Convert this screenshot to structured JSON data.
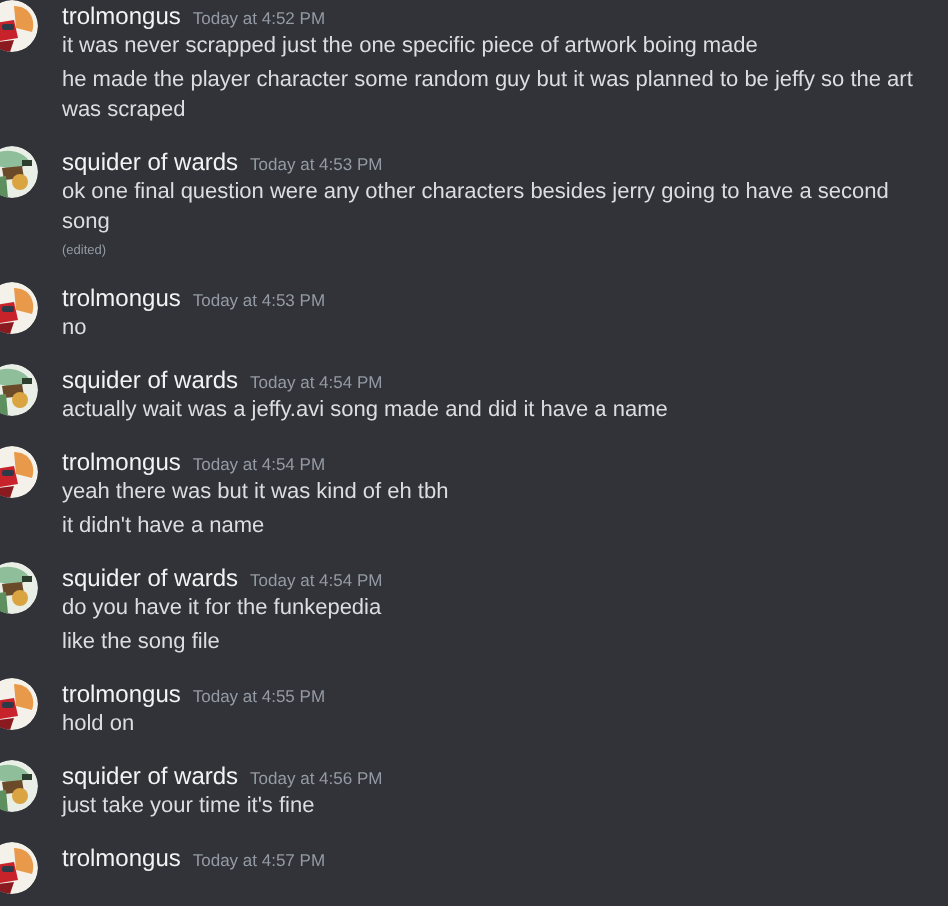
{
  "messages": [
    {
      "author": "trolmongus",
      "time": "Today at 4:52 PM",
      "lines": [
        {
          "text": "it was  never scrapped just the one specific piece of artwork boing made",
          "edited": false
        },
        {
          "text": "he made the player character  some random guy but it was planned to be jeffy so the art was scraped",
          "edited": false
        }
      ]
    },
    {
      "author": "squider of wards",
      "time": "Today at 4:53 PM",
      "lines": [
        {
          "text": "ok one final question were any other characters besides jerry going to have a second song",
          "edited": true,
          "edited_label": "(edited)"
        }
      ]
    },
    {
      "author": "trolmongus",
      "time": "Today at 4:53 PM",
      "lines": [
        {
          "text": "no",
          "edited": false
        }
      ]
    },
    {
      "author": "squider of wards",
      "time": "Today at 4:54 PM",
      "lines": [
        {
          "text": "actually wait was a jeffy.avi song made and did it have a name",
          "edited": false
        }
      ]
    },
    {
      "author": "trolmongus",
      "time": "Today at 4:54 PM",
      "lines": [
        {
          "text": "yeah there was but it was  kind of eh tbh",
          "edited": false
        },
        {
          "text": "it didn't have a name",
          "edited": false
        }
      ]
    },
    {
      "author": "squider of wards",
      "time": "Today at 4:54 PM",
      "lines": [
        {
          "text": "do you have it for the funkepedia",
          "edited": false
        },
        {
          "text": "like the song file",
          "edited": false
        }
      ]
    },
    {
      "author": "trolmongus",
      "time": "Today at 4:55 PM",
      "lines": [
        {
          "text": "hold on",
          "edited": false
        }
      ]
    },
    {
      "author": "squider of wards",
      "time": "Today at 4:56 PM",
      "lines": [
        {
          "text": "just take your time it's fine",
          "edited": false
        }
      ]
    },
    {
      "author": "trolmongus",
      "time": "Today at 4:57 PM"
    }
  ]
}
